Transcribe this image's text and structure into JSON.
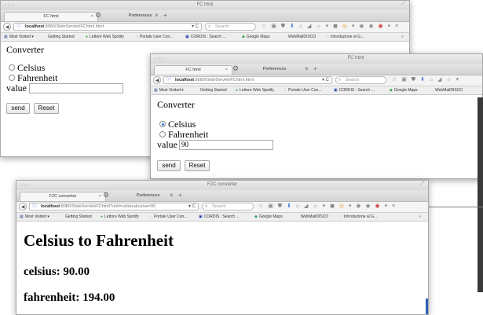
{
  "window1": {
    "title": "FC html",
    "tabs": [
      {
        "label": "FC html"
      },
      {
        "label": "Preferences"
      }
    ],
    "url": {
      "host": "localhost",
      "path": ":8080/SlideServlet/FChtml.html"
    },
    "search_placeholder": "Search",
    "bookmarks": [
      "Most Visited",
      "Getting Started",
      "Lettore Web Spotify",
      "Portale User Con...",
      "CORDIS : Search ...",
      "Google Maps",
      "WebMailDISCO",
      "Introduzione al G..."
    ],
    "form": {
      "heading": "Converter",
      "options": [
        {
          "label": "Celsius",
          "checked": false
        },
        {
          "label": "Fahrenheit",
          "checked": false
        }
      ],
      "value_label": "value",
      "value": "",
      "send_label": "send",
      "reset_label": "Reset"
    }
  },
  "window2": {
    "title": "FC html",
    "tabs": [
      {
        "label": "FC html"
      },
      {
        "label": "Preferences"
      }
    ],
    "url": {
      "host": "localhost",
      "path": ":8080/SlideServlet/FChtml.html"
    },
    "search_placeholder": "Search",
    "bookmarks": [
      "Most Visited",
      "Getting Started",
      "Lettore Web Spotify",
      "Portale User Con...",
      "CORDIS : Search ...",
      "Google Maps",
      "WebMailDISCO"
    ],
    "form": {
      "heading": "Converter",
      "options": [
        {
          "label": "Celsius",
          "checked": true
        },
        {
          "label": "Fahrenheit",
          "checked": false
        }
      ],
      "value_label": "value",
      "value": "90",
      "send_label": "send",
      "reset_label": "Reset"
    }
  },
  "window3": {
    "title": "F2C converter",
    "tabs": [
      {
        "label": "F2C converter"
      },
      {
        "label": "Preferences"
      }
    ],
    "url": {
      "host": "localhost",
      "path": ":8080/SlideServlet/FChtml?unit=celsius&value=90"
    },
    "search_placeholder": "Search",
    "bookmarks": [
      "Most Visited",
      "Getting Started",
      "Lettore Web Spotify",
      "Portale User Con...",
      "CORDIS : Search ...",
      "Google Maps",
      "WebMailDISCO",
      "Introduzione al G..."
    ],
    "result": {
      "heading": "Celsius to Fahrenheit",
      "celsius_line": "celsius: 90.00",
      "fahrenheit_line": "fahrenheit: 194.00"
    }
  },
  "colors": {
    "radio_checked": "#2a6fe0",
    "scrollbar": "#2e5fb8",
    "lock": "#4a77c6"
  }
}
